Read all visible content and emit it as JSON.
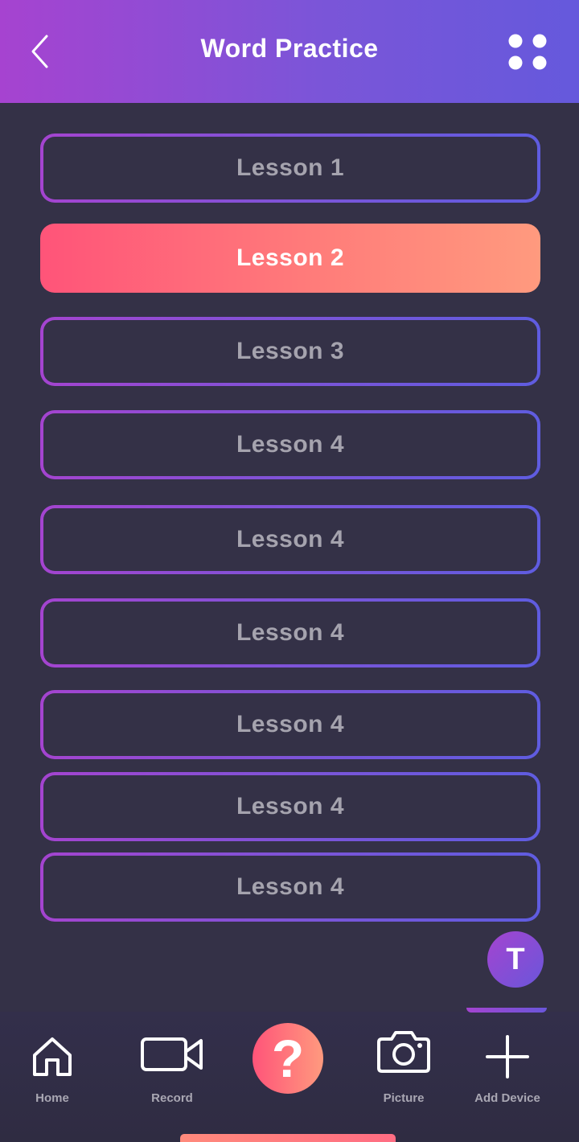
{
  "header": {
    "title": "Word Practice",
    "back_icon": "chevron-left-icon",
    "menu_icon": "grid-dots-icon"
  },
  "lessons": [
    {
      "label": "Lesson 1",
      "state": "default"
    },
    {
      "label": "Lesson 2",
      "state": "selected"
    },
    {
      "label": "Lesson 3",
      "state": "default"
    },
    {
      "label": "Lesson 4",
      "state": "default"
    },
    {
      "label": "Lesson 4",
      "state": "default"
    },
    {
      "label": "Lesson 4",
      "state": "default"
    },
    {
      "label": "Lesson 4",
      "state": "default"
    },
    {
      "label": "Lesson 4",
      "state": "default"
    },
    {
      "label": "Lesson 4",
      "state": "default"
    }
  ],
  "avatar": {
    "initial": "T"
  },
  "tabbar": {
    "home": {
      "label": "Home",
      "icon": "home-icon"
    },
    "record": {
      "label": "Record",
      "icon": "video-camera-icon"
    },
    "help": {
      "symbol": "?",
      "icon": "question-icon"
    },
    "picture": {
      "label": "Picture",
      "icon": "camera-icon"
    },
    "add_device": {
      "label": "Add Device",
      "icon": "plus-icon"
    }
  },
  "colors": {
    "background": "#343147",
    "header_gradient": [
      "#a643d0",
      "#6559dc"
    ],
    "active_gradient": [
      "#ff5479",
      "#ff9a7e"
    ],
    "outline_gradient": [
      "#a444d0",
      "#5f5ce0"
    ],
    "muted_text": "#a5a3ae"
  }
}
